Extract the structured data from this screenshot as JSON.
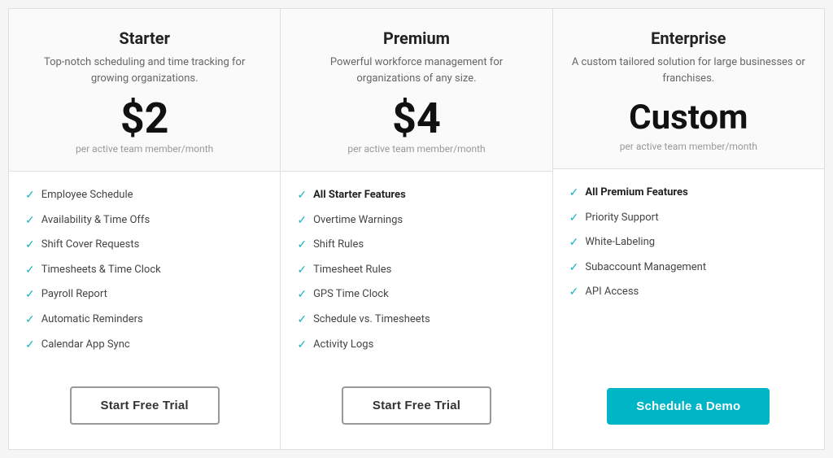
{
  "cards": [
    {
      "id": "starter",
      "title": "Starter",
      "description": "Top-notch scheduling and time tracking for growing organizations.",
      "price": "$2",
      "price_period": "per active team member/month",
      "features": [
        {
          "text": "Employee Schedule",
          "bold": false
        },
        {
          "text": "Availability & Time Offs",
          "bold": false
        },
        {
          "text": "Shift Cover Requests",
          "bold": false
        },
        {
          "text": "Timesheets & Time Clock",
          "bold": false
        },
        {
          "text": "Payroll Report",
          "bold": false
        },
        {
          "text": "Automatic Reminders",
          "bold": false
        },
        {
          "text": "Calendar App Sync",
          "bold": false
        }
      ],
      "cta_label": "Start Free Trial",
      "cta_type": "outline"
    },
    {
      "id": "premium",
      "title": "Premium",
      "description": "Powerful workforce management for organizations of any size.",
      "price": "$4",
      "price_period": "per active team member/month",
      "features": [
        {
          "text": "All Starter Features",
          "bold": true
        },
        {
          "text": "Overtime Warnings",
          "bold": false
        },
        {
          "text": "Shift Rules",
          "bold": false
        },
        {
          "text": "Timesheet Rules",
          "bold": false
        },
        {
          "text": "GPS Time Clock",
          "bold": false
        },
        {
          "text": "Schedule vs. Timesheets",
          "bold": false
        },
        {
          "text": "Activity Logs",
          "bold": false
        }
      ],
      "cta_label": "Start Free Trial",
      "cta_type": "outline"
    },
    {
      "id": "enterprise",
      "title": "Enterprise",
      "description": "A custom tailored solution for large businesses or franchises.",
      "price": "Custom",
      "price_period": "per active team member/month",
      "features": [
        {
          "text": "All Premium Features",
          "bold": true
        },
        {
          "text": "Priority Support",
          "bold": false
        },
        {
          "text": "White-Labeling",
          "bold": false
        },
        {
          "text": "Subaccount Management",
          "bold": false
        },
        {
          "text": "API Access",
          "bold": false
        }
      ],
      "cta_label": "Schedule a Demo",
      "cta_type": "primary"
    }
  ],
  "check_symbol": "✔"
}
